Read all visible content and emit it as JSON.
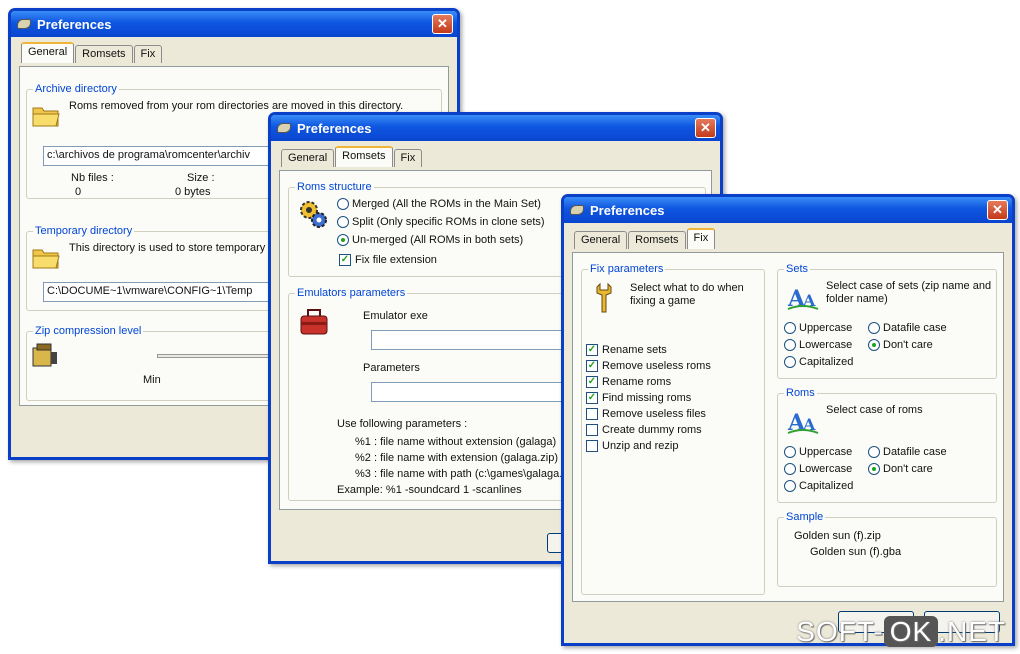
{
  "w1": {
    "title": "Preferences",
    "tabs": [
      "General",
      "Romsets",
      "Fix"
    ],
    "archive": {
      "label": "Archive directory",
      "desc": "Roms removed from your rom directories are moved in this directory.",
      "path": "c:\\archivos de programa\\romcenter\\archiv",
      "nbfiles_label": "Nb files :",
      "nbfiles_value": "0",
      "size_label": "Size :",
      "size_value": "0 bytes"
    },
    "temp": {
      "label": "Temporary directory",
      "desc": "This directory is used to store temporary",
      "path": "C:\\DOCUME~1\\vmware\\CONFIG~1\\Temp"
    },
    "zip": {
      "label": "Zip compression level",
      "min": "Min"
    }
  },
  "w2": {
    "title": "Preferences",
    "tabs": [
      "General",
      "Romsets",
      "Fix"
    ],
    "roms": {
      "label": "Roms structure",
      "merged": "Merged (All the ROMs in the Main Set)",
      "split": "Split (Only specific ROMs in clone sets)",
      "unmerged": "Un-merged (All ROMs in both sets)",
      "fixext": "Fix file extension"
    },
    "emu": {
      "label": "Emulators parameters",
      "exe_label": "Emulator exe",
      "params_label": "Parameters",
      "use_label": "Use following parameters :",
      "p1": "%1 : file name without extension (galaga)",
      "p2": "%2 : file name with extension (galaga.zip)",
      "p3": "%3 : file name with path (c:\\games\\galaga.zi",
      "example": "Example: %1 -soundcard 1 -scanlines"
    }
  },
  "w3": {
    "title": "Preferences",
    "tabs": [
      "General",
      "Romsets",
      "Fix"
    ],
    "fix": {
      "label": "Fix parameters",
      "desc": "Select what to do when fixing a game",
      "items": [
        {
          "label": "Rename sets",
          "checked": true
        },
        {
          "label": "Remove useless roms",
          "checked": true
        },
        {
          "label": "Rename roms",
          "checked": true
        },
        {
          "label": "Find missing roms",
          "checked": true
        },
        {
          "label": "Remove useless files",
          "checked": false
        },
        {
          "label": "Create dummy roms",
          "checked": false
        },
        {
          "label": "Unzip and rezip",
          "checked": false
        }
      ]
    },
    "sets": {
      "label": "Sets",
      "desc": "Select case of sets (zip name and folder name)",
      "uppercase": "Uppercase",
      "datafile": "Datafile case",
      "lowercase": "Lowercase",
      "dontcare": "Don't care",
      "capitalized": "Capitalized"
    },
    "roms": {
      "label": "Roms",
      "desc": "Select case of roms",
      "uppercase": "Uppercase",
      "datafile": "Datafile case",
      "lowercase": "Lowercase",
      "dontcare": "Don't care",
      "capitalized": "Capitalized"
    },
    "sample": {
      "label": "Sample",
      "line1": "Golden sun (f).zip",
      "line2": "Golden sun (f).gba"
    }
  },
  "watermark": {
    "pre": "SOFT-",
    "ok": "OK",
    "post": ".NET"
  }
}
